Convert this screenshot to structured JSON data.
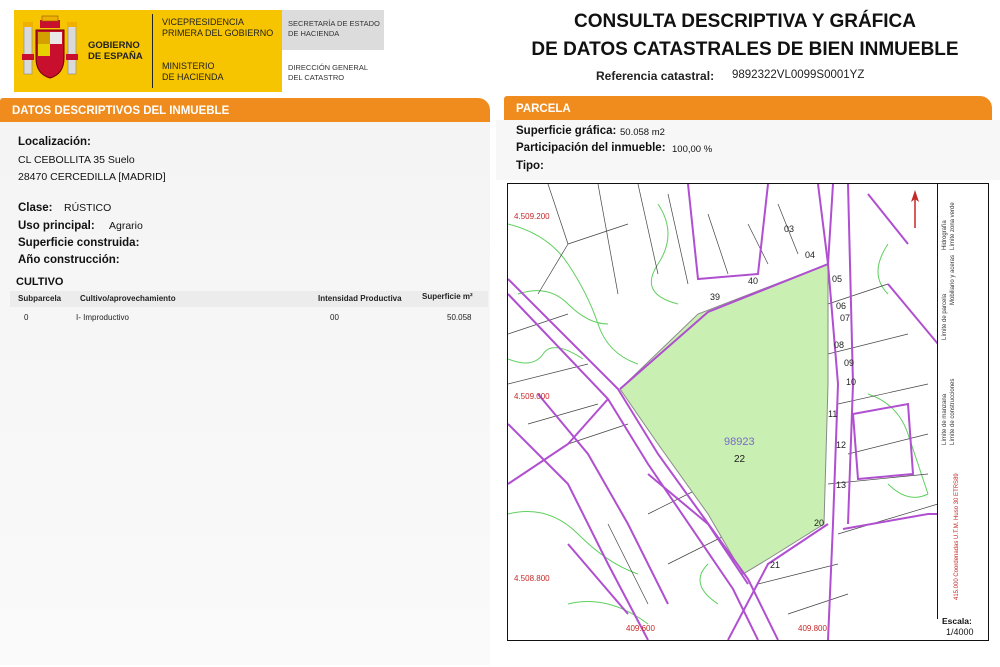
{
  "header": {
    "gov_lines": [
      "GOBIERNO",
      "DE ESPAÑA"
    ],
    "vice_lines": [
      "VICEPRESIDENCIA",
      "PRIMERA DEL GOBIERNO"
    ],
    "min_lines": [
      "MINISTERIO",
      "DE HACIENDA"
    ],
    "sec_lines": [
      "SECRETARÍA DE ESTADO",
      "DE HACIENDA"
    ],
    "dir_lines": [
      "DIRECCIÓN GENERAL",
      "DEL CATASTRO"
    ],
    "title_line1": "CONSULTA DESCRIPTIVA Y GRÁFICA",
    "title_line2": "DE DATOS CATASTRALES DE BIEN INMUEBLE",
    "ref_label": "Referencia catastral:",
    "ref_value": "9892322VL0099S0001YZ"
  },
  "left": {
    "section_title": "DATOS DESCRIPTIVOS DEL INMUEBLE",
    "loc_label": "Localización:",
    "loc_line1": "CL CEBOLLITA 35 Suelo",
    "loc_line2": "28470 CERCEDILLA [MADRID]",
    "clase_label": "Clase:",
    "clase_value": "RÚSTICO",
    "uso_label": "Uso principal:",
    "uso_value": "Agrario",
    "sup_label": "Superficie construida:",
    "anio_label": "Año construcción:",
    "cultivo_title": "CULTIVO",
    "table": {
      "headers": [
        "Subparcela",
        "Cultivo/aprovechamiento",
        "Intensidad Productiva",
        "Superficie m²"
      ],
      "rows": [
        [
          "0",
          "I- Improductivo",
          "00",
          "50.058"
        ]
      ]
    }
  },
  "right": {
    "section_title": "PARCELA",
    "sup_label": "Superficie gráfica:",
    "sup_value": "50.058 m2",
    "part_label": "Participación del inmueble:",
    "part_value": "100,00 %",
    "tipo_label": "Tipo:"
  },
  "map": {
    "coords": [
      "4.509.200",
      "4.509.000",
      "4.508.800",
      "409.600",
      "409.800"
    ],
    "parcel_ref": "98923",
    "parcel_num": "22",
    "lots": [
      "39",
      "40",
      "04",
      "05",
      "06",
      "07",
      "08",
      "09",
      "10",
      "11",
      "12",
      "13",
      "20",
      "21",
      "03"
    ],
    "legend": [
      "Límite de manzana",
      "Límite de parcela",
      "Límite de construcciones",
      "Mobiliario y aceras",
      "Límite zona verde",
      "Hidrografía"
    ],
    "legend_footer": "415.000 Coordenadas U.T.M. Huso 30 ETRS89",
    "scale_label": "Escala:",
    "scale_value": "1/4000"
  },
  "colors": {
    "accent": "#f08c1e",
    "gov_yellow": "#f7c500",
    "parcel_fill": "#c9efb2",
    "block_line": "#b04fd0",
    "contour": "#5fcf5f",
    "coord_red": "#c62828"
  }
}
